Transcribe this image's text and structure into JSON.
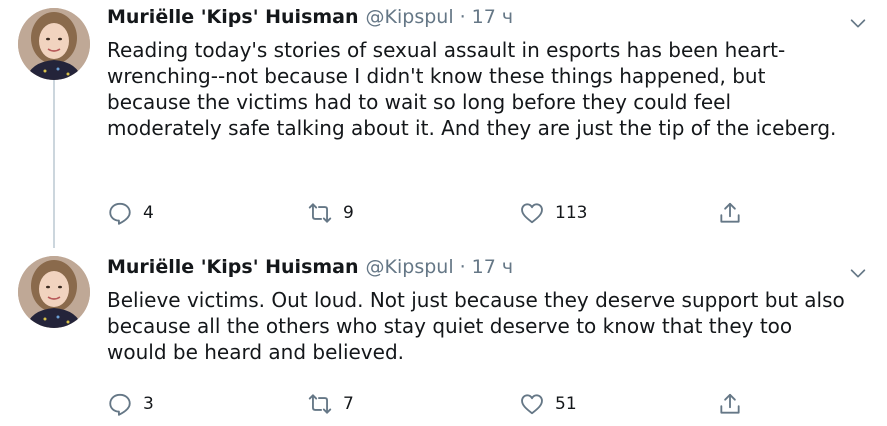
{
  "tweets": [
    {
      "author_name": "Muriëlle 'Kips' Huisman",
      "handle": "@Kipspul",
      "separator": "·",
      "time": "17 ч",
      "text": "Reading today's stories of sexual assault in esports has been heart-wrenching--not because I didn't know these things happened, but because the victims had to wait so long before they could feel moderately safe talking about it. And they are just the tip of the iceberg.",
      "replies": "4",
      "retweets": "9",
      "likes": "113"
    },
    {
      "author_name": "Muriëlle 'Kips' Huisman",
      "handle": "@Kipspul",
      "separator": "·",
      "time": "17 ч",
      "text": "Believe victims. Out loud. Not just because they deserve support but also because all the others who stay quiet deserve to know that they too would be heard and believed.",
      "replies": "3",
      "retweets": "7",
      "likes": "51"
    }
  ],
  "icons": {
    "reply": "reply-icon",
    "retweet": "retweet-icon",
    "like": "heart-icon",
    "share": "share-icon",
    "more": "chevron-down-icon"
  },
  "colors": {
    "text": "#14171a",
    "secondary": "#657786",
    "thread_line": "#ccd6dd"
  }
}
